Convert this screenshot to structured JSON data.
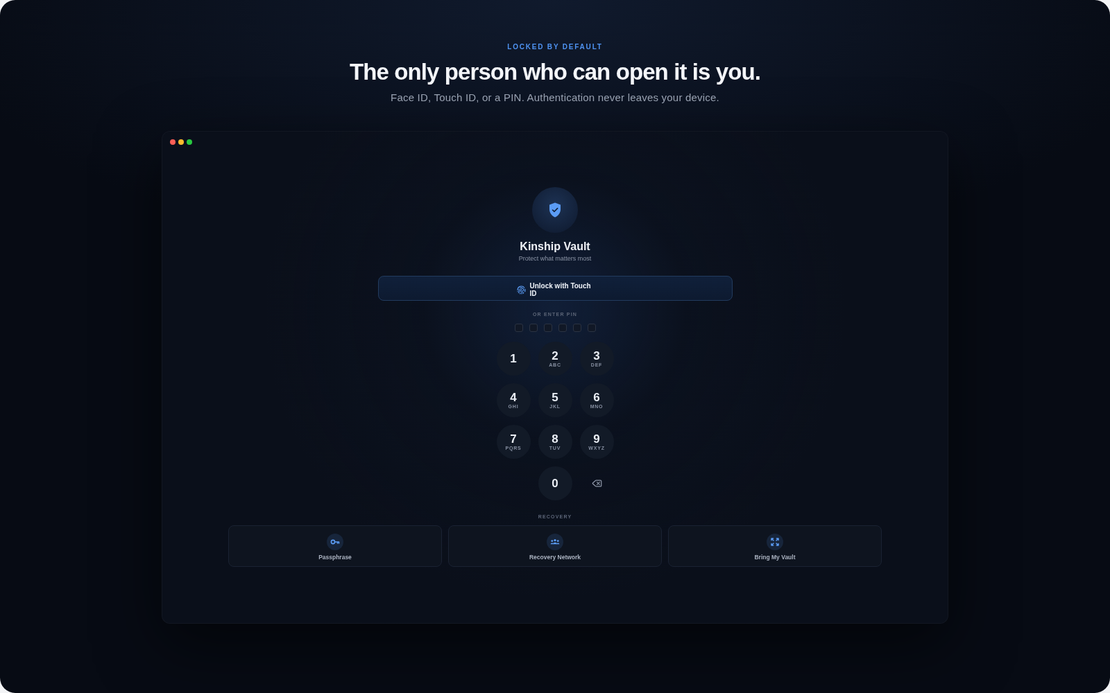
{
  "page": {
    "eyebrow": "LOCKED BY DEFAULT",
    "headline": "The only person who can open it is you.",
    "subheadline": "Face ID, Touch ID, or a PIN. Authentication never leaves your device."
  },
  "window": {
    "app_title": "Kinship Vault",
    "tagline": "Protect what matters most",
    "biometric_button": {
      "label": "Unlock with Touch ID"
    },
    "pin_label": "OR ENTER PIN",
    "pin_slots": [
      {
        "filled": false
      },
      {
        "filled": false
      },
      {
        "filled": false
      },
      {
        "filled": false
      },
      {
        "filled": false
      },
      {
        "filled": false
      }
    ],
    "keypad": [
      {
        "kind": "digit",
        "digit": "1"
      },
      {
        "kind": "digit",
        "digit": "2",
        "letters": "ABC"
      },
      {
        "kind": "digit",
        "digit": "3",
        "letters": "DEF"
      },
      {
        "kind": "digit",
        "digit": "4",
        "letters": "GHI"
      },
      {
        "kind": "digit",
        "digit": "5",
        "letters": "JKL"
      },
      {
        "kind": "digit",
        "digit": "6",
        "letters": "MNO"
      },
      {
        "kind": "digit",
        "digit": "7",
        "letters": "PQRS"
      },
      {
        "kind": "digit",
        "digit": "8",
        "letters": "TUV"
      },
      {
        "kind": "digit",
        "digit": "9",
        "letters": "WXYZ"
      },
      {
        "kind": "digit",
        "digit": "0"
      },
      {
        "kind": "delete"
      }
    ],
    "recovery_label": "RECOVERY",
    "recovery_options": [
      {
        "kind": "passphrase",
        "label": "Passphrase"
      },
      {
        "kind": "network",
        "label": "Recovery Network"
      },
      {
        "kind": "transfer",
        "label": "Bring My Vault"
      }
    ]
  }
}
